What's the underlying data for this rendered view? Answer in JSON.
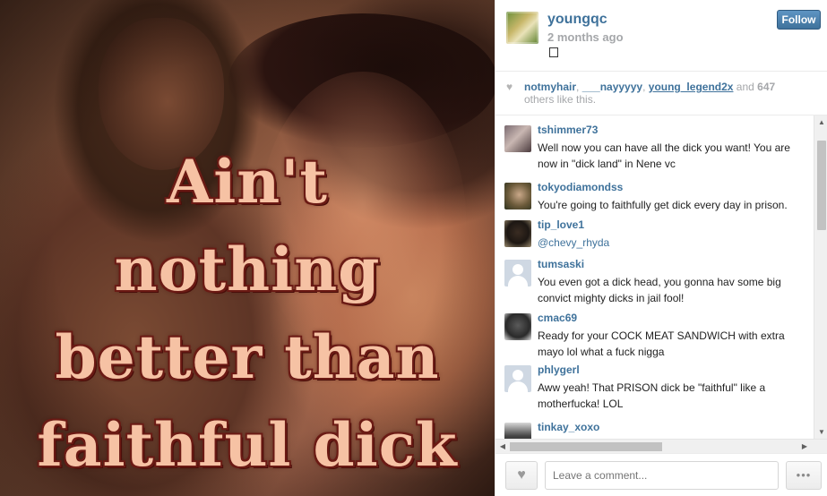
{
  "photo": {
    "caption_lines": [
      "Ain't",
      "nothing",
      "better than",
      "faithful dick"
    ]
  },
  "post": {
    "username": "youngqc",
    "timestamp": "2 months ago",
    "follow_label": "Follow"
  },
  "likes": {
    "users": [
      "notmyhair",
      "___nayyyyy",
      "young_legend2x"
    ],
    "separator": ", ",
    "and_text": " and ",
    "count": "647",
    "suffix": "others like this."
  },
  "comments": [
    {
      "user": "tshimmer73",
      "text": "Well now you can have all the dick you want! You are now in \"dick land\" in Nene vc"
    },
    {
      "user": "tokyodiamondss",
      "text": "You're going to faithfully get dick every day in prison."
    },
    {
      "user": "tip_love1",
      "mention": "@chevy_rhyda"
    },
    {
      "user": "tumsaski",
      "text": "You even got a dick head, you gonna hav some big convict mighty dicks in jail fool!"
    },
    {
      "user": "cmac69",
      "text": "Ready for your COCK MEAT SANDWICH with extra mayo lol what a fuck nigga"
    },
    {
      "user": "phlygerl",
      "text": "Aww yeah! That PRISON dick be \"faithful\" like a motherfucka! LOL"
    },
    {
      "user": "tinkay_xoxo",
      "text": ""
    }
  ],
  "footer": {
    "comment_placeholder": "Leave a comment...",
    "more_label": "•••"
  },
  "icons": {
    "heart": "heart-icon",
    "more": "more-icon"
  },
  "colors": {
    "link": "#3f729b",
    "muted": "#a5a7aa",
    "follow_button": "#3f729b"
  }
}
